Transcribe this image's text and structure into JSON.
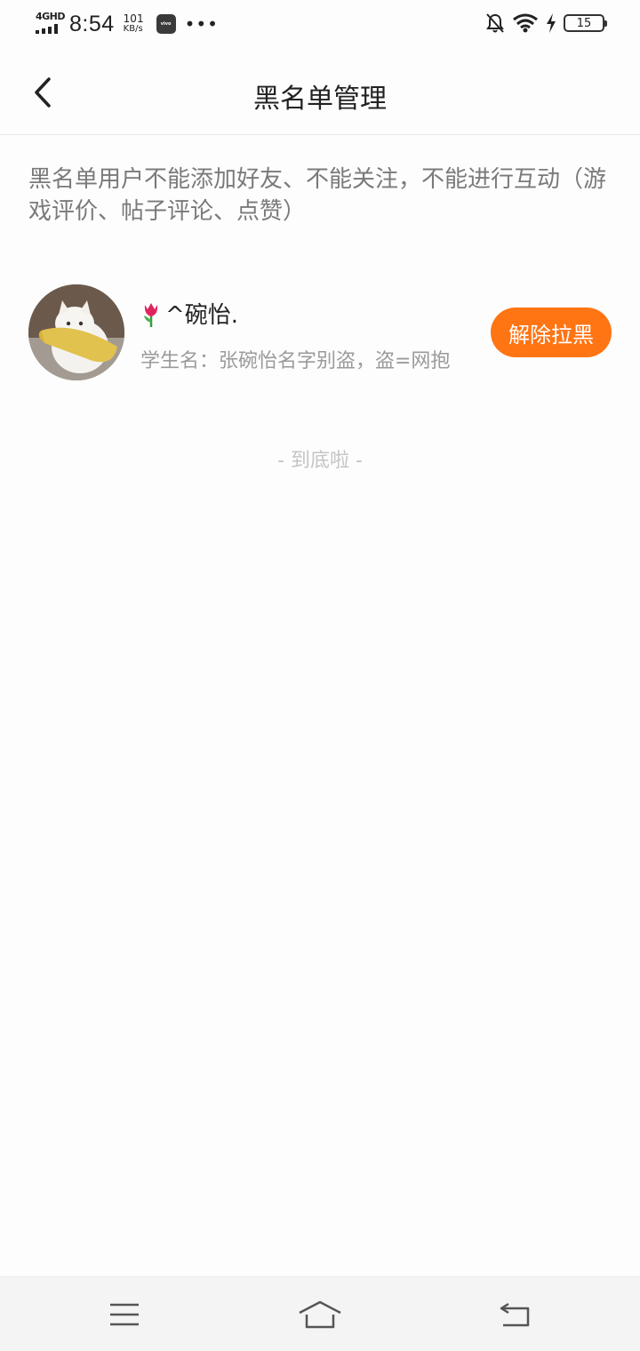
{
  "status_bar": {
    "network": "4GHD",
    "time": "8:54",
    "speed_value": "101",
    "speed_unit": "KB/s",
    "vivo_badge": "vivo",
    "more": "•••",
    "battery": "15"
  },
  "header": {
    "title": "黑名单管理"
  },
  "notice": "黑名单用户不能添加好友、不能关注，不能进行互动（游戏评价、帖子评论、点赞）",
  "blocked_users": [
    {
      "name": "^碗怡.",
      "subtitle": "学生名：张碗怡名字别盗，盗=网抱",
      "action_label": "解除拉黑"
    }
  ],
  "end_of_list": "- 到底啦 -",
  "colors": {
    "accent": "#ff7413",
    "notice_text": "#7a7a7a",
    "sub_text": "#9b9b9b"
  },
  "icons": {
    "back": "chevron-left-icon",
    "menu": "menu-icon",
    "home": "home-icon",
    "return": "return-icon"
  }
}
